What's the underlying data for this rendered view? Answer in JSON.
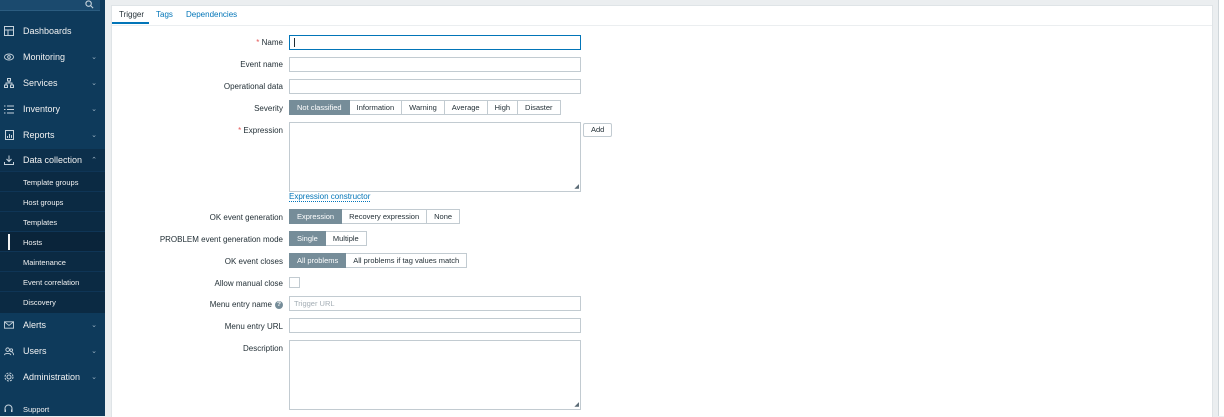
{
  "sidebar": {
    "items": [
      {
        "label": "Dashboards",
        "icon": "dashboards-icon",
        "chevron": ""
      },
      {
        "label": "Monitoring",
        "icon": "eye-icon",
        "chevron": "⌄"
      },
      {
        "label": "Services",
        "icon": "services-icon",
        "chevron": "⌄"
      },
      {
        "label": "Inventory",
        "icon": "list-icon",
        "chevron": "⌄"
      },
      {
        "label": "Reports",
        "icon": "reports-icon",
        "chevron": "⌄"
      },
      {
        "label": "Data collection",
        "icon": "download-icon",
        "chevron": "⌃"
      }
    ],
    "submenu": [
      "Template groups",
      "Host groups",
      "Templates",
      "Hosts",
      "Maintenance",
      "Event correlation",
      "Discovery"
    ],
    "items_bottom": [
      {
        "label": "Alerts",
        "icon": "envelope-icon",
        "chevron": "⌄"
      },
      {
        "label": "Users",
        "icon": "users-icon",
        "chevron": "⌄"
      },
      {
        "label": "Administration",
        "icon": "gear-icon",
        "chevron": "⌄"
      }
    ],
    "support": "Support"
  },
  "tabs": [
    "Trigger",
    "Tags",
    "Dependencies"
  ],
  "form": {
    "name_label": "Name",
    "event_name_label": "Event name",
    "operational_data_label": "Operational data",
    "severity_label": "Severity",
    "severity_options": [
      "Not classified",
      "Information",
      "Warning",
      "Average",
      "High",
      "Disaster"
    ],
    "expression_label": "Expression",
    "add_button": "Add",
    "expression_constructor": "Expression constructor",
    "ok_event_generation_label": "OK event generation",
    "ok_event_generation_options": [
      "Expression",
      "Recovery expression",
      "None"
    ],
    "problem_mode_label": "PROBLEM event generation mode",
    "problem_mode_options": [
      "Single",
      "Multiple"
    ],
    "ok_event_closes_label": "OK event closes",
    "ok_event_closes_options": [
      "All problems",
      "All problems if tag values match"
    ],
    "allow_manual_close_label": "Allow manual close",
    "menu_entry_name_label": "Menu entry name",
    "menu_entry_name_placeholder": "Trigger URL",
    "menu_entry_url_label": "Menu entry URL",
    "description_label": "Description",
    "required_mark": "*",
    "help_mark": "?"
  },
  "colors": {
    "sidebar": "#0e3a5b",
    "accent": "#0275b8",
    "selected": "#768d99",
    "required": "#e45959"
  }
}
